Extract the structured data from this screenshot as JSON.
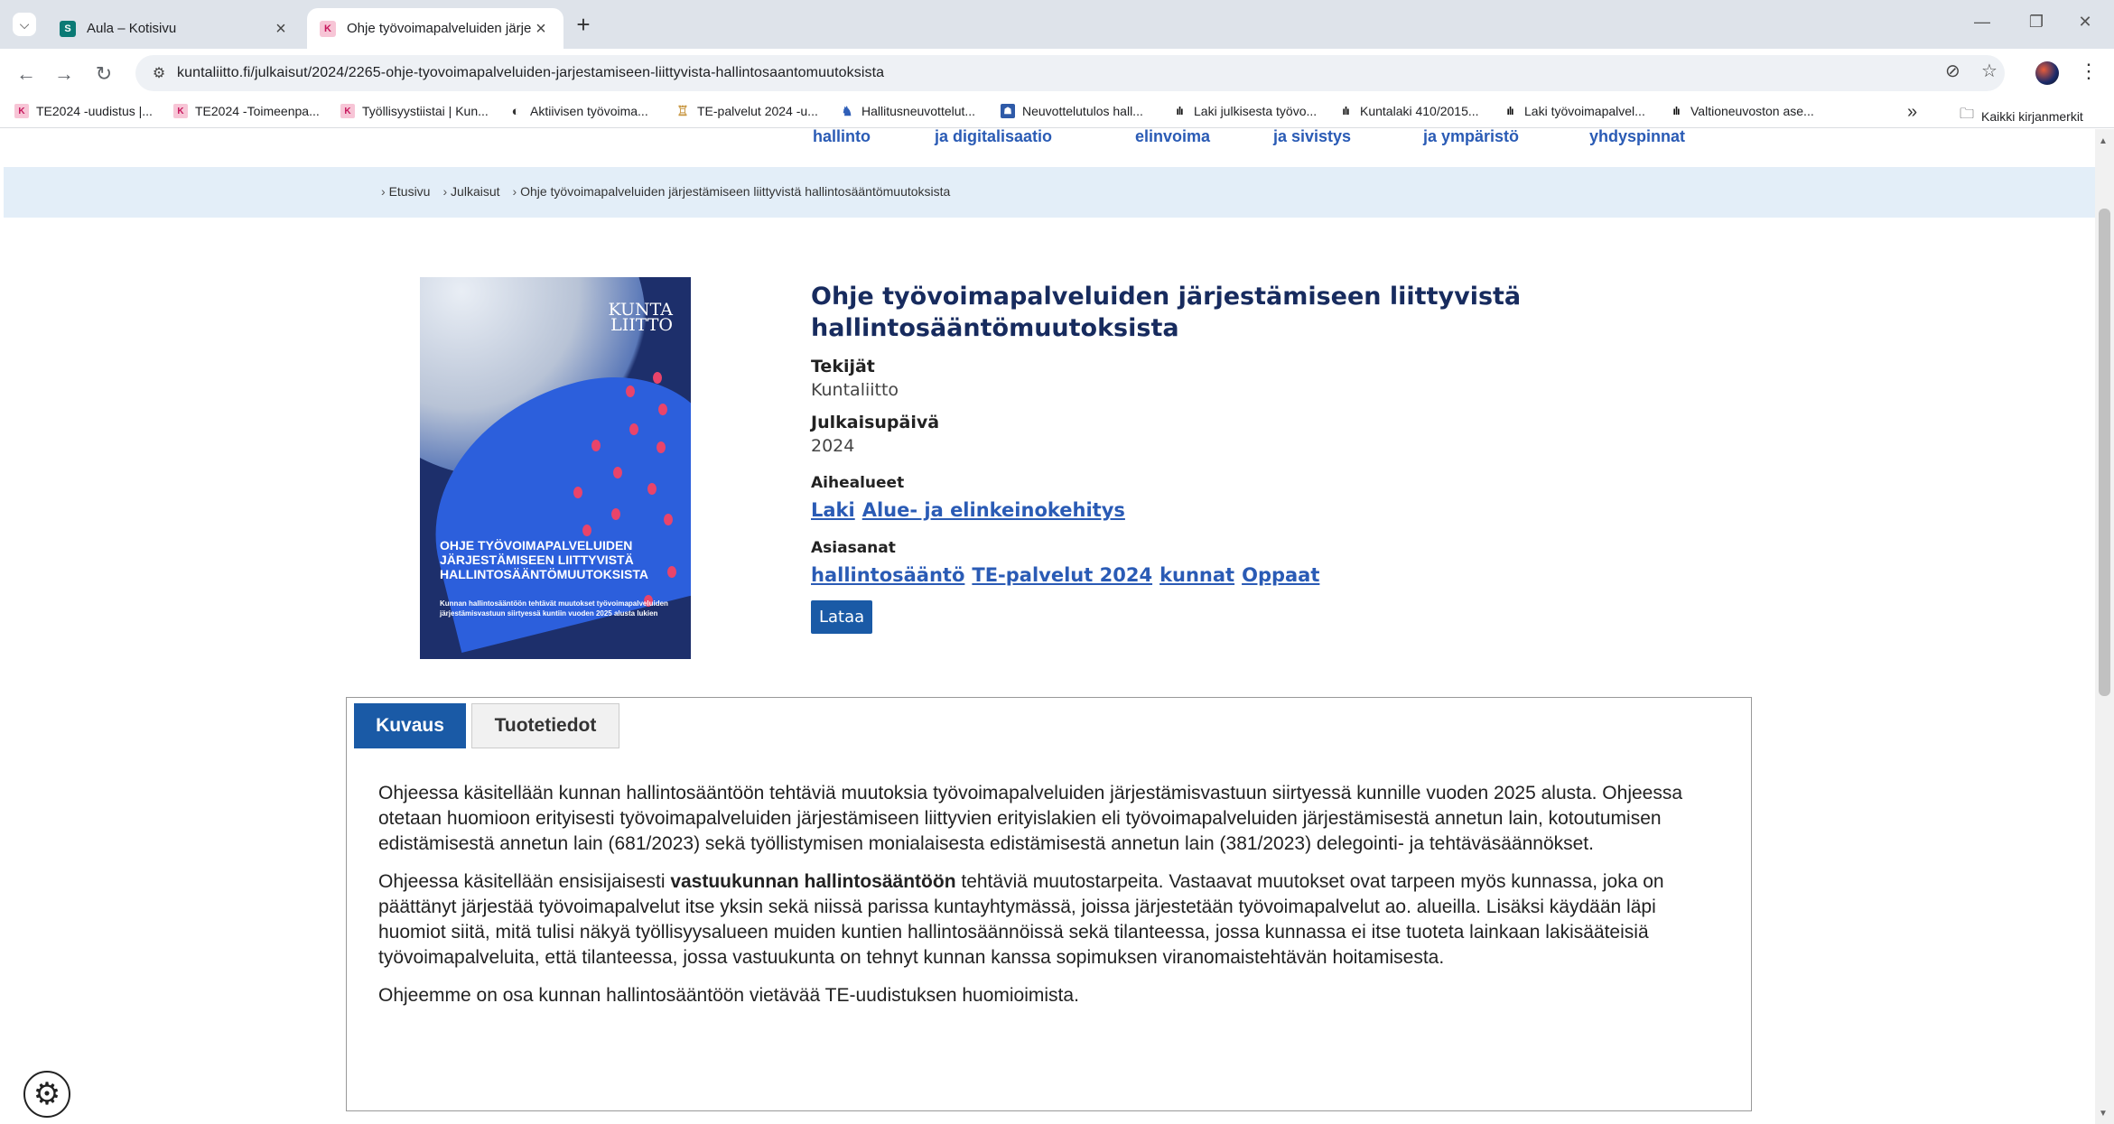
{
  "browser": {
    "tabs": [
      {
        "title": "Aula – Kotisivu",
        "favicon": "sharepoint-icon",
        "active": false
      },
      {
        "title": "Ohje työvoimapalveluiden järjes",
        "favicon": "kuntaliitto-icon",
        "active": true
      }
    ],
    "url": "kuntaliitto.fi/julkaisut/2024/2265-ohje-tyovoimapalveluiden-jarjestamiseen-liittyvista-hallintosaantomuutoksista",
    "bookmarks": [
      "TE2024 -uudistus |...",
      "TE2024 -Toimeenpa...",
      "Työllisyystiistai | Kun...",
      "Aktiivisen työvoima...",
      "TE-palvelut 2024 -u...",
      "Hallitusneuvottelut...",
      "Neuvottelutulos hall...",
      "Laki julkisesta työvo...",
      "Kuntalaki 410/2015...",
      "Laki työvoimapalvel...",
      "Valtioneuvoston ase..."
    ],
    "all_bookmarks": "Kaikki kirjanmerkit"
  },
  "nav": [
    "hallinto",
    "ja digitalisaatio",
    "elinvoima",
    "ja sivistys",
    "ja ympäristö",
    "yhdyspinnat"
  ],
  "breadcrumbs": [
    "Etusivu",
    "Julkaisut",
    "Ohje työvoimapalveluiden järjestämiseen liittyvistä hallintosääntömuutoksista"
  ],
  "cover": {
    "logo_line1": "KUNTA",
    "logo_line2": "LIITTO",
    "title": "OHJE TYÖVOIMAPALVELUIDEN JÄRJESTÄMISEEN LIITTYVISTÄ HALLINTOSÄÄNTÖMUUTOKSISTA",
    "subtitle": "Kunnan hallintosääntöön tehtävät muutokset työvoimapalveluiden järjestämisvastuun siirtyessä kuntiin vuoden 2025 alusta lukien"
  },
  "publication": {
    "title": "Ohje työvoimapalveluiden järjestämiseen liittyvistä hallintosääntömuutoksista",
    "authors_label": "Tekijät",
    "authors": "Kuntaliitto",
    "date_label": "Julkaisupäivä",
    "date": "2024",
    "topics_label": "Aihealueet",
    "topics": [
      "Laki",
      "Alue- ja elinkeinokehitys"
    ],
    "keywords_label": "Asiasanat",
    "keywords": [
      "hallintosääntö",
      "TE-palvelut 2024",
      "kunnat",
      "Oppaat"
    ],
    "download_label": "Lataa"
  },
  "tabs": {
    "description": "Kuvaus",
    "product": "Tuotetiedot"
  },
  "description": {
    "p1": "Ohjeessa käsitellään kunnan hallintosääntöön tehtäviä muutoksia työvoimapalveluiden järjestämisvastuun siirtyessä kunnille vuoden 2025 alusta. Ohjeessa otetaan huomioon erityisesti työvoimapalveluiden järjestämiseen liittyvien erityislakien eli työvoimapalveluiden järjestämisestä annetun lain, kotoutumisen edistämisestä annetun lain (681/2023) sekä työllistymisen monialaisesta edistämisestä annetun lain (381/2023) delegointi- ja tehtäväsäännökset.",
    "p2_before": "Ohjeessa käsitellään ensisijaisesti ",
    "p2_bold": "vastuukunnan hallintosääntöön",
    "p2_after": " tehtäviä muutostarpeita. Vastaavat muutokset ovat tarpeen myös kunnassa, joka on päättänyt järjestää työvoimapalvelut itse yksin sekä niissä parissa kuntayhtymässä, joissa järjestetään työvoimapalvelut ao. alueilla. Lisäksi käydään läpi huomiot siitä, mitä tulisi näkyä työllisyysalueen muiden kuntien hallintosäännöissä sekä tilanteessa, jossa kunnassa ei itse tuoteta lainkaan lakisääteisiä työvoimapalveluita, että tilanteessa, jossa vastuukunta on tehnyt kunnan kanssa sopimuksen viranomaistehtävän hoitamisesta.",
    "p3": "Ohjeemme on osa kunnan hallintosääntöön vietävää TE-uudistuksen huomioimista."
  }
}
